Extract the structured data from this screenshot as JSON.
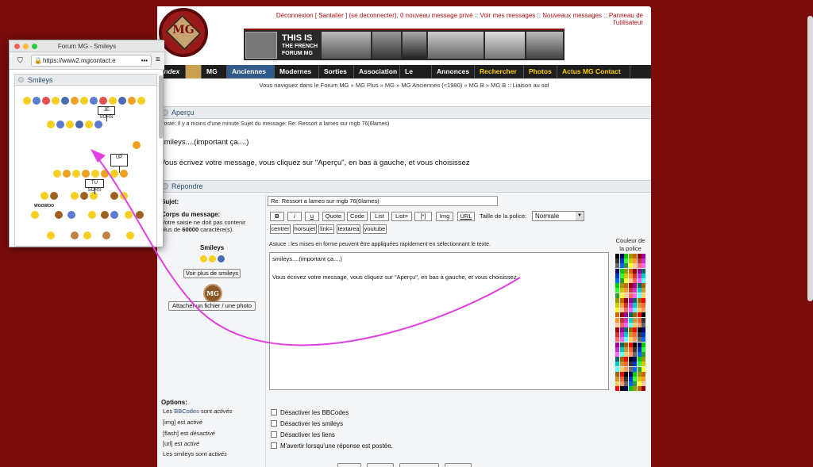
{
  "toplinks": [
    "Déconnexion [ Santalier ] (se deconnecter), 0 nouveau message privé",
    "Voir mes messages",
    "Nouveaux messages",
    "Panneau de l'utilisateur"
  ],
  "logo_text": "MG",
  "banner": {
    "line1": "THIS IS",
    "line2": "THE FRENCH",
    "line3": "FORUM MG"
  },
  "nav": [
    "Index",
    "MG",
    "Anciennes",
    "Modernes",
    "Sorties",
    "Association",
    "Le Pub",
    "Annonces",
    "Rechercher",
    "Photos",
    "Actus MG Contact"
  ],
  "breadcrumb": "Vous naviguez dans le Forum MG » MG Plus » MG » MG Anciennes (<1980) » MG B » MG B :: Liaison au sol",
  "apercu": {
    "title": "Aperçu",
    "meta": "Posté: Il y a moins d'une minute     Sujet du message: Re: Ressort a lames sur mgb 76(6lames)",
    "line1": "smileys....(important ça....)",
    "line2": "Vous écrivez votre message, vous cliquez sur \"Aperçu\", en bas à gauche, et vous choisissez"
  },
  "repondre": {
    "title": "Répondre",
    "subject_label": "Sujet:",
    "subject_value": "Re: Ressort a lames sur mgb 76(6lames)",
    "body_label": "Corps du message:",
    "body_hint1": "Votre saisie ne doit pas contenir",
    "body_hint2_pre": "plus de ",
    "body_hint2_num": "60000",
    "body_hint2_post": " caractère(s).",
    "smileys_label": "Smileys",
    "more_smileys": "Voir plus de smileys",
    "attach": "Attacher un fichier / une photo",
    "bbcodes": [
      "B",
      "i",
      "u",
      "Quote",
      "Code",
      "List",
      "List=",
      "[*]",
      "Img",
      "URL"
    ],
    "bbcodes2": [
      "centrer",
      "horsujet",
      "link=",
      "textarea",
      "youtube"
    ],
    "font_size_label": "Taille de la police:",
    "font_size_value": "Normale",
    "hint": "Astuce : les mises en forme peuvent être appliquées rapidement en sélectionnant le texte.",
    "color_label1": "Couleur de",
    "color_label2": "la police",
    "textarea_line1": "smileys....(important ça....)",
    "textarea_line2": "Vous écrivez votre message, vous cliquez sur \"Aperçu\", en bas à gauche, et vous choisissez"
  },
  "options": {
    "title": "Options:",
    "lines": [
      {
        "pre": "Les ",
        "link": "BBCodes",
        "post": " sont ",
        "state": "activés"
      },
      {
        "pre": "[img] est ",
        "link": "",
        "post": "",
        "state": "activé"
      },
      {
        "pre": "[flash] est ",
        "link": "",
        "post": "",
        "state": "désactivé"
      },
      {
        "pre": "[url] est ",
        "link": "",
        "post": "",
        "state": "activé"
      },
      {
        "pre": "Les smileys sont ",
        "link": "",
        "post": "",
        "state": "activés"
      }
    ],
    "checkboxes": [
      "Désactiver les BBCodes",
      "Désactiver les smileys",
      "Désactiver les liens",
      "M'avertir lorsqu'une réponse est postée."
    ]
  },
  "popup": {
    "title": "Forum MG - Smileys",
    "url": "https://www2.mgcontact.e",
    "header": "Smileys",
    "sign1": "JE SORS",
    "sign2": "UP",
    "sign3": "TU SORS",
    "woowoo": "WOOWOO"
  },
  "colors": {
    "accent_red": "#7a0c0c",
    "nav_active": "#2f5a8a",
    "arrow": "#e040e0"
  }
}
